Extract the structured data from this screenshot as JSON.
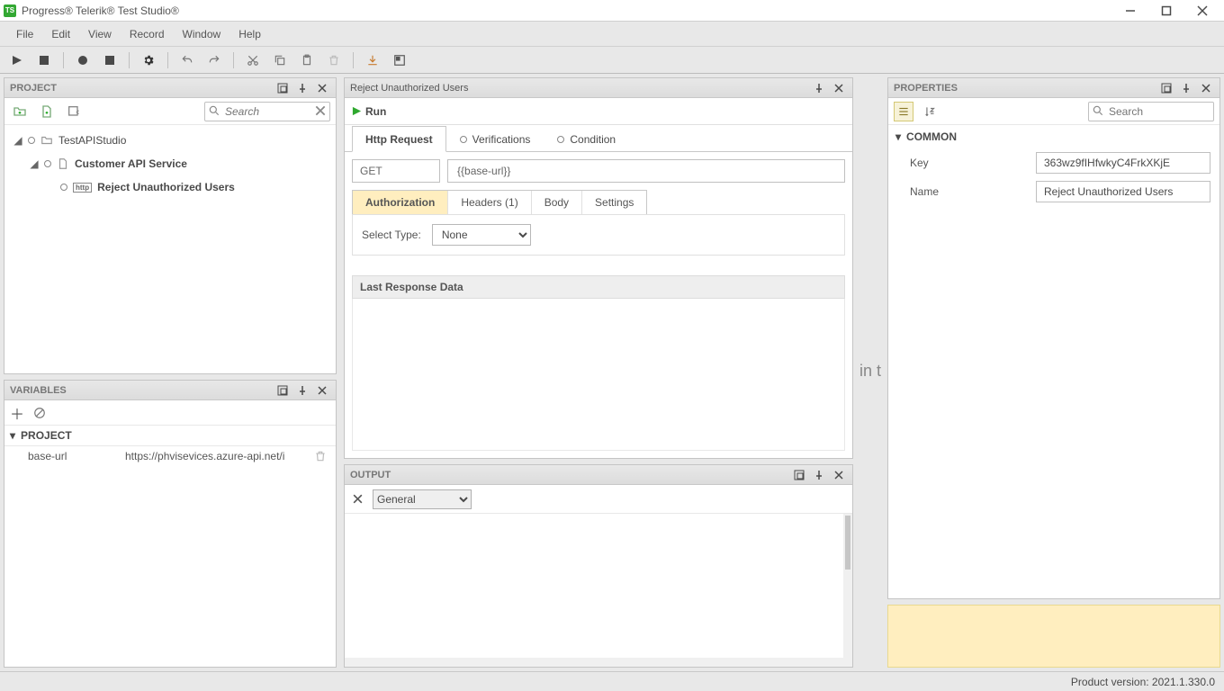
{
  "titlebar": {
    "title": "Progress® Telerik® Test Studio®"
  },
  "menu": [
    "File",
    "Edit",
    "View",
    "Record",
    "Window",
    "Help"
  ],
  "panels": {
    "project": "PROJECT",
    "variables": "VARIABLES",
    "output": "OUTPUT",
    "properties": "PROPERTIES",
    "editor": "Reject Unauthorized Users",
    "section_project": "PROJECT"
  },
  "search": {
    "placeholder": "Search"
  },
  "tree": {
    "root": "TestAPIStudio",
    "svc": "Customer API Service",
    "step": "Reject Unauthorized Users"
  },
  "vars": {
    "name": "base-url",
    "value": "https://phvisevices.azure-api.net/i"
  },
  "editor": {
    "run": "Run",
    "tabs": {
      "http": "Http Request",
      "ver": "Verifications",
      "cond": "Condition"
    },
    "method": "GET",
    "url": "{{base-url}}",
    "subtabs": {
      "auth": "Authorization",
      "headers": "Headers (1)",
      "body": "Body",
      "settings": "Settings"
    },
    "selectTypeLabel": "Select Type:",
    "selectTypeValue": "None",
    "lastResp": "Last Response Data"
  },
  "output": {
    "filter": "General"
  },
  "props": {
    "cat": "COMMON",
    "keyLabel": "Key",
    "keyValue": "363wz9fIHfwkyC4FrkXKjE",
    "nameLabel": "Name",
    "nameValue": "Reject Unauthorized Users"
  },
  "between": "in t",
  "status": "Product version: 2021.1.330.0"
}
